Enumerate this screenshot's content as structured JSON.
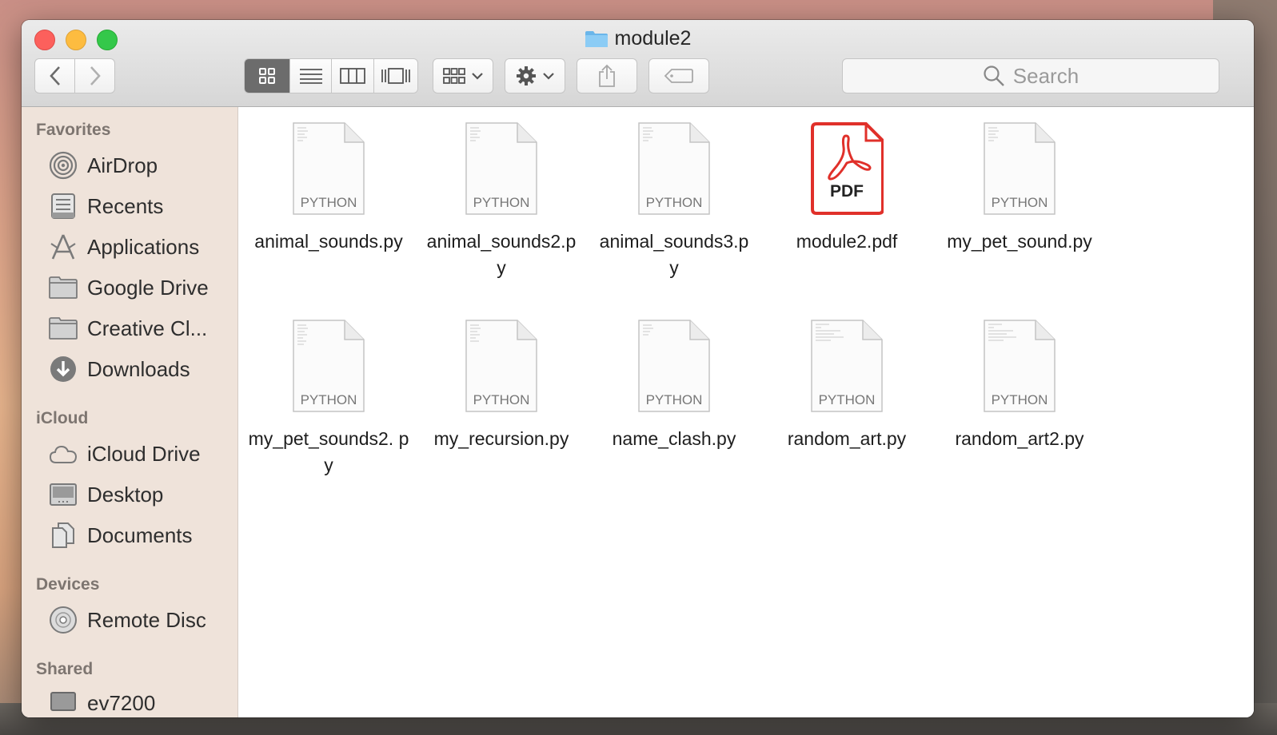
{
  "window": {
    "title": "module2"
  },
  "toolbar": {
    "back_icon": "chevron-left-icon",
    "forward_icon": "chevron-right-icon",
    "view_modes": [
      "icon-view",
      "list-view",
      "column-view",
      "cover-flow-view"
    ],
    "active_view": "icon-view",
    "search_placeholder": "Search"
  },
  "sidebar": {
    "sections": [
      {
        "heading": "Favorites",
        "items": [
          {
            "label": "AirDrop",
            "icon": "airdrop-icon"
          },
          {
            "label": "Recents",
            "icon": "recents-icon"
          },
          {
            "label": "Applications",
            "icon": "applications-icon"
          },
          {
            "label": "Google Drive",
            "icon": "folder-icon"
          },
          {
            "label": "Creative Cl...",
            "icon": "folder-icon"
          },
          {
            "label": "Downloads",
            "icon": "downloads-icon"
          }
        ]
      },
      {
        "heading": "iCloud",
        "items": [
          {
            "label": "iCloud Drive",
            "icon": "cloud-icon"
          },
          {
            "label": "Desktop",
            "icon": "desktop-icon"
          },
          {
            "label": "Documents",
            "icon": "documents-icon"
          }
        ]
      },
      {
        "heading": "Devices",
        "items": [
          {
            "label": "Remote Disc",
            "icon": "disc-icon"
          }
        ]
      },
      {
        "heading": "Shared",
        "items": [
          {
            "label": "ev7200",
            "icon": "computer-icon"
          }
        ]
      }
    ]
  },
  "files": [
    {
      "name": "animal_sounds.py",
      "kind": "PYTHON"
    },
    {
      "name": "animal_sounds2.p y",
      "kind": "PYTHON"
    },
    {
      "name": "animal_sounds3.p y",
      "kind": "PYTHON"
    },
    {
      "name": "module2.pdf",
      "kind": "PDF"
    },
    {
      "name": "my_pet_sound.py",
      "kind": "PYTHON"
    },
    {
      "name": "my_pet_sounds2. py",
      "kind": "PYTHON"
    },
    {
      "name": "my_recursion.py",
      "kind": "PYTHON"
    },
    {
      "name": "name_clash.py",
      "kind": "PYTHON"
    },
    {
      "name": "random_art.py",
      "kind": "PYTHON"
    },
    {
      "name": "random_art2.py",
      "kind": "PYTHON"
    }
  ],
  "colors": {
    "pdf_red": "#e0302a",
    "folder_blue": "#6ab6ea",
    "sidebar_bg": "#efe3da"
  }
}
